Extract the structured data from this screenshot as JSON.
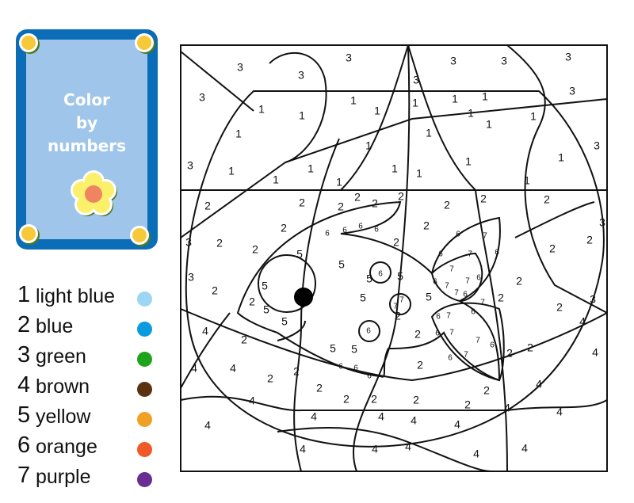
{
  "card": {
    "title_lines": [
      "Color",
      "by",
      "numbers"
    ],
    "frame_color": "#0b6db7",
    "panel_color": "#9fc6ea",
    "icon": "flower-icon"
  },
  "legend": [
    {
      "number": "1",
      "label": "light blue",
      "color": "#9dd6f2"
    },
    {
      "number": "2",
      "label": "blue",
      "color": "#0a9ade"
    },
    {
      "number": "3",
      "label": "green",
      "color": "#1fa31d"
    },
    {
      "number": "4",
      "label": "brown",
      "color": "#5a3210"
    },
    {
      "number": "5",
      "label": "yellow",
      "color": "#f0a024"
    },
    {
      "number": "6",
      "label": "orange",
      "color": "#ef5a26"
    },
    {
      "number": "7",
      "label": "purple",
      "color": "#6a2d94"
    }
  ],
  "picture": {
    "subject": "fish",
    "region_numbers": [
      "3",
      "3",
      "3",
      "3",
      "3",
      "3",
      "3",
      "3",
      "3",
      "3",
      "3",
      "3",
      "3",
      "3",
      "3",
      "1",
      "1",
      "1",
      "1",
      "1",
      "1",
      "1",
      "1",
      "1",
      "1",
      "1",
      "1",
      "1",
      "1",
      "1",
      "1",
      "1",
      "1",
      "1",
      "1",
      "1",
      "1",
      "2",
      "2",
      "2",
      "2",
      "2",
      "2",
      "2",
      "2",
      "2",
      "2",
      "2",
      "2",
      "2",
      "2",
      "2",
      "2",
      "2",
      "2",
      "2",
      "2",
      "2",
      "2",
      "2",
      "2",
      "2",
      "2",
      "2",
      "2",
      "2",
      "2",
      "2",
      "2",
      "2",
      "2",
      "2",
      "4",
      "4",
      "4",
      "4",
      "4",
      "4",
      "4",
      "4",
      "4",
      "4",
      "4",
      "4",
      "4",
      "4",
      "4",
      "4",
      "4",
      "4",
      "4",
      "5",
      "5",
      "5",
      "5",
      "5",
      "5",
      "5",
      "5",
      "5",
      "5",
      "5",
      "6",
      "6",
      "6",
      "6",
      "6",
      "6",
      "6",
      "6",
      "6",
      "6",
      "6",
      "6",
      "6",
      "6",
      "6",
      "6",
      "6",
      "6",
      "6",
      "6",
      "7",
      "7",
      "7",
      "7",
      "7",
      "7",
      "7",
      "7",
      "7",
      "7",
      "7",
      "7",
      "7"
    ]
  }
}
